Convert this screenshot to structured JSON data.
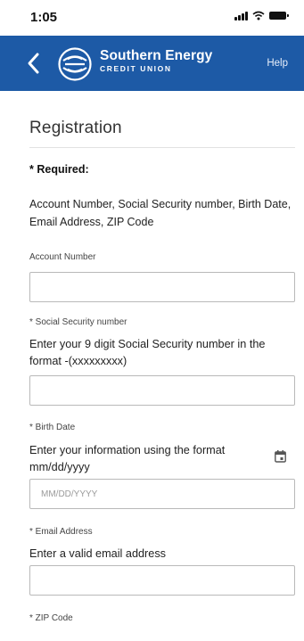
{
  "status_bar": {
    "time": "1:05"
  },
  "header": {
    "brand_name": "Southern Energy",
    "brand_sub": "CREDIT UNION",
    "help_label": "Help",
    "back_icon": "chevron-left-icon",
    "logo_icon": "credit-union-logo",
    "color": "#1d5aa6"
  },
  "page": {
    "title": "Registration",
    "required_label": "* Required:",
    "required_fields": "Account Number, Social Security number, Birth Date, Email Address, ZIP Code"
  },
  "fields": {
    "account": {
      "label": "Account Number",
      "value": ""
    },
    "ssn": {
      "label": "* Social Security number",
      "help": "Enter your 9 digit Social Security number in the format -(xxxxxxxxx)",
      "value": ""
    },
    "birth": {
      "label": "* Birth Date",
      "help": "Enter your information using the format mm/dd/yyyy",
      "placeholder": "MM/DD/YYYY",
      "icon": "calendar-icon"
    },
    "email": {
      "label": "* Email Address",
      "help": "Enter a valid email address",
      "value": ""
    },
    "zip": {
      "label": "* ZIP Code"
    }
  }
}
